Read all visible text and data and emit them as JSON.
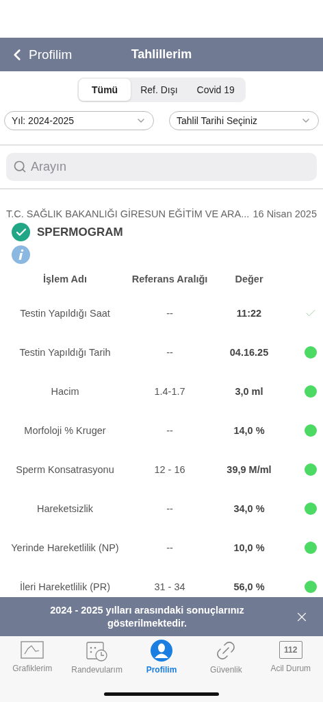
{
  "nav": {
    "back": "Profilim",
    "title": "Tahlillerim"
  },
  "segments": [
    {
      "label": "Tümü",
      "selected": true
    },
    {
      "label": "Ref. Dışı",
      "selected": false
    },
    {
      "label": "Covid 19",
      "selected": false
    }
  ],
  "filters": [
    {
      "value": "Yıl: 2024-2025"
    },
    {
      "value": "Tahlil Tarihi Seçiniz"
    }
  ],
  "search": {
    "placeholder": "Arayın"
  },
  "report": {
    "institution": "T.C. SAĞLIK BAKANLIĞI GİRESUN EĞİTİM VE ARA...",
    "date": "16 Nisan 2025",
    "test": "SPERMOGRAM",
    "verified": true
  },
  "table": {
    "columns": [
      "İşlem Adı",
      "Referans Aralığı",
      "Değer"
    ],
    "rows": [
      {
        "name": "Testin Yapıldığı Saat",
        "range": "--",
        "value": "11:22",
        "kind": "check"
      },
      {
        "name": "Testin Yapıldığı Tarih",
        "range": "--",
        "value": "04.16.25",
        "kind": "dot"
      },
      {
        "name": "Hacim",
        "range": "1.4-1.7",
        "value": "3,0 ml",
        "kind": "dot"
      },
      {
        "name": "Morfoloji % Kruger",
        "range": "--",
        "value": "14,0 %",
        "kind": "dot"
      },
      {
        "name": "Sperm Konsatrasyonu",
        "range": "12 - 16",
        "value": "39,9 M/ml",
        "kind": "dot"
      },
      {
        "name": "Hareketsizlik",
        "range": "--",
        "value": "34,0 %",
        "kind": "dot"
      },
      {
        "name": "Yerinde Hareketlilik (NP)",
        "range": "--",
        "value": "10,0 %",
        "kind": "dot"
      },
      {
        "name": "İleri Hareketlilik (PR)",
        "range": "31 - 34",
        "value": "56,0 %",
        "kind": "dot"
      }
    ]
  },
  "banner": {
    "text": "2024 - 2025 yılları arasındaki sonuçlarınız gösterilmektedir."
  },
  "tabs": [
    {
      "label": "Grafiklerim",
      "kind": "chart",
      "selected": false
    },
    {
      "label": "Randevularım",
      "kind": "calendar",
      "selected": false
    },
    {
      "label": "Profilim",
      "kind": "person",
      "selected": true
    },
    {
      "label": "Güvenlik",
      "kind": "link",
      "selected": false
    },
    {
      "label": "Acil Durum",
      "kind": "emergency",
      "badge": "112",
      "selected": false
    }
  ]
}
